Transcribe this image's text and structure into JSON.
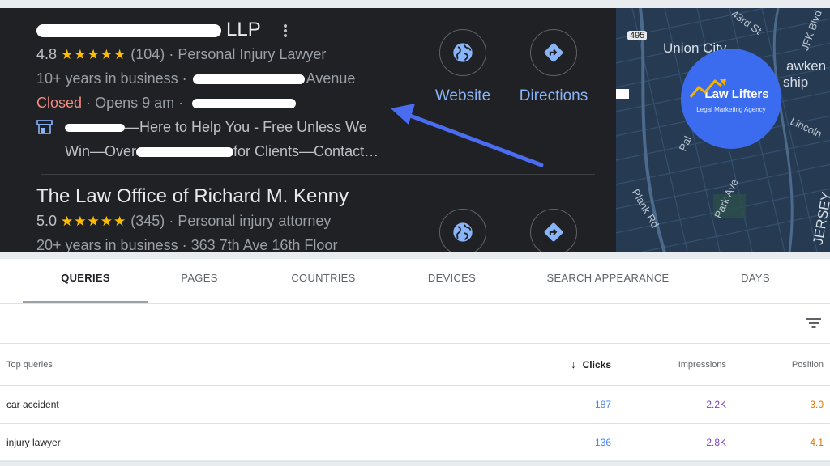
{
  "listings": [
    {
      "name_suffix": "LLP",
      "rating": "4.8",
      "stars": "★★★★★",
      "reviews": "(104)",
      "category": "Personal Injury Lawyer",
      "years": "10+ years in business",
      "address_suffix": "Avenue",
      "status": "Closed",
      "hours": "Opens 9 am",
      "desc_line1": "—Here to Help You - Free Unless We",
      "desc_line2_a": "Win—Over",
      "desc_line2_b": "for Clients—Contact…"
    },
    {
      "name": "The Law Office of Richard M. Kenny",
      "rating": "5.0",
      "stars": "★★★★★",
      "reviews": "(345)",
      "category": "Personal injury attorney",
      "years": "20+ years in business",
      "address": "363 7th Ave 16th Floor"
    }
  ],
  "actions": {
    "website": "Website",
    "directions": "Directions"
  },
  "separator": "·",
  "map": {
    "labels": [
      "Union City",
      "43rd St",
      "JFK Blvd",
      "495",
      "awken",
      "ship",
      "Lincoln",
      "Park Ave",
      "Pal",
      "JERSEY",
      "Plank Rd"
    ]
  },
  "logo": {
    "title": "Law Lifters",
    "subtitle": "Legal Marketing Agency"
  },
  "tabs": [
    "QUERIES",
    "PAGES",
    "COUNTRIES",
    "DEVICES",
    "SEARCH APPEARANCE",
    "DAYS"
  ],
  "table": {
    "headers": {
      "query": "Top queries",
      "clicks": "Clicks",
      "impressions": "Impressions",
      "position": "Position"
    },
    "sort_arrow": "↓",
    "rows": [
      {
        "query": "car accident",
        "clicks": "187",
        "impressions": "2.2K",
        "position": "3.0"
      },
      {
        "query": "injury lawyer",
        "clicks": "136",
        "impressions": "2.8K",
        "position": "4.1"
      }
    ]
  },
  "colors": {
    "link_blue": "#8ab4f8",
    "star": "#fbbc04",
    "closed": "#f28b82",
    "clicks": "#4285f4",
    "impressions": "#7b3fbf",
    "position": "#e37400",
    "arrow": "#4a6cf0",
    "badge": "#3b6cf0"
  }
}
